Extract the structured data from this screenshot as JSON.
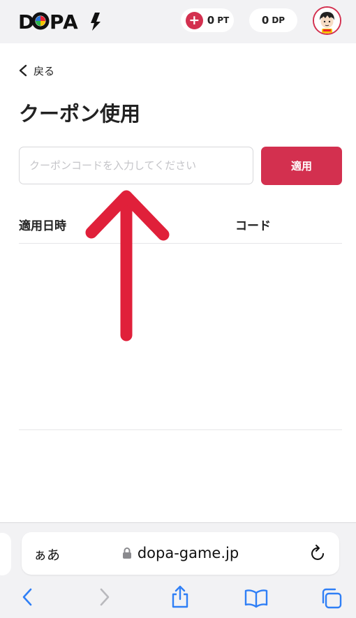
{
  "header": {
    "logo": "DOPA!",
    "points": {
      "value": "0",
      "unit": "PT"
    },
    "dopa_points": {
      "value": "0",
      "unit": "DP"
    }
  },
  "back": {
    "label": "戻る"
  },
  "page_title": "クーポン使用",
  "coupon": {
    "placeholder": "クーポンコードを入力してください",
    "apply_label": "適用"
  },
  "table": {
    "headers": [
      "適用日時",
      "コード"
    ],
    "rows": []
  },
  "browser": {
    "text_size_label": "ぁあ",
    "url": "dopa-game.jp"
  },
  "colors": {
    "accent": "#d3304f",
    "arrow": "#e0203a"
  }
}
